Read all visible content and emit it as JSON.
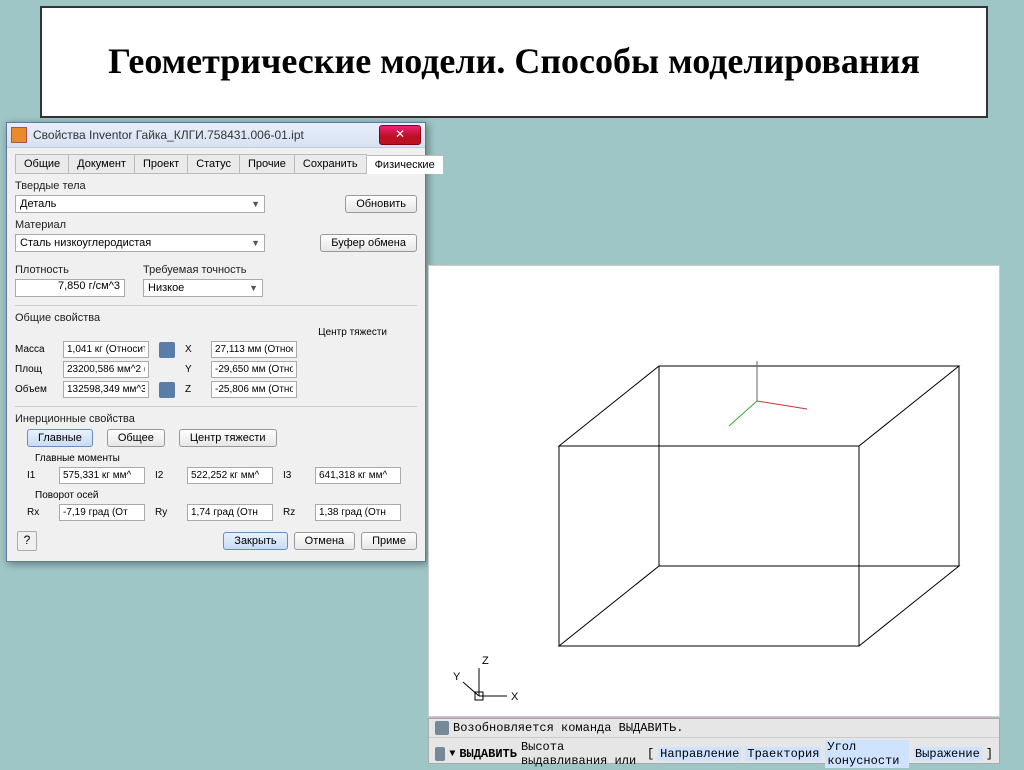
{
  "slide": {
    "title": "Геометрические модели. Способы моделирования"
  },
  "dialog": {
    "title": "Свойства Inventor Гайка_КЛГИ.758431.006-01.ipt",
    "close": "✕",
    "tabs": [
      "Общие",
      "Документ",
      "Проект",
      "Статус",
      "Прочие",
      "Сохранить",
      "Физические"
    ],
    "active_tab": 6,
    "solids": {
      "label": "Твердые тела",
      "value": "Деталь",
      "update_btn": "Обновить"
    },
    "material": {
      "label": "Материал",
      "value": "Сталь низкоуглеродистая",
      "clipboard_btn": "Буфер обмена"
    },
    "density": {
      "label": "Плотность",
      "value": "7,850 г/см^3",
      "precision_label": "Требуемая точность",
      "precision_value": "Низкое"
    },
    "general_props": {
      "label": "Общие свойства",
      "centroid_label": "Центр тяжести",
      "rows": [
        {
          "name": "Масса",
          "val": "1,041 кг (Относит",
          "ax": "X",
          "cv": "27,113 мм (Относи"
        },
        {
          "name": "Площ",
          "val": "23200,586 мм^2 (С",
          "ax": "Y",
          "cv": "-29,650 мм (Относи"
        },
        {
          "name": "Объем",
          "val": "132598,349 мм^3 (",
          "ax": "Z",
          "cv": "-25,806 мм (Относи"
        }
      ]
    },
    "inertia": {
      "label": "Инерционные свойства",
      "main_btn": "Главные",
      "global_btn": "Общее",
      "centroid_btn": "Центр тяжести",
      "moments_label": "Главные моменты",
      "moments": [
        {
          "k": "I1",
          "v": "575,331 кг мм^"
        },
        {
          "k": "I2",
          "v": "522,252 кг мм^"
        },
        {
          "k": "I3",
          "v": "641,318 кг мм^"
        }
      ],
      "rot_label": "Поворот осей",
      "rot": [
        {
          "k": "Rx",
          "v": "-7,19 град (От"
        },
        {
          "k": "Ry",
          "v": "1,74 град (Отн"
        },
        {
          "k": "Rz",
          "v": "1,38 град (Отн"
        }
      ]
    },
    "footer": {
      "close": "Закрыть",
      "cancel": "Отмена",
      "apply": "Приме"
    }
  },
  "viewport": {
    "axes": {
      "x": "X",
      "y": "Y",
      "z": "Z"
    }
  },
  "command": {
    "resume": "Возобновляется команда ВЫДАВИТЬ.",
    "cmd_kw": "ВЫДАВИТЬ",
    "prompt": "Высота выдавливания или",
    "opts": [
      "Направление",
      "Траектория",
      "Угол конусности",
      "Выражение"
    ]
  }
}
